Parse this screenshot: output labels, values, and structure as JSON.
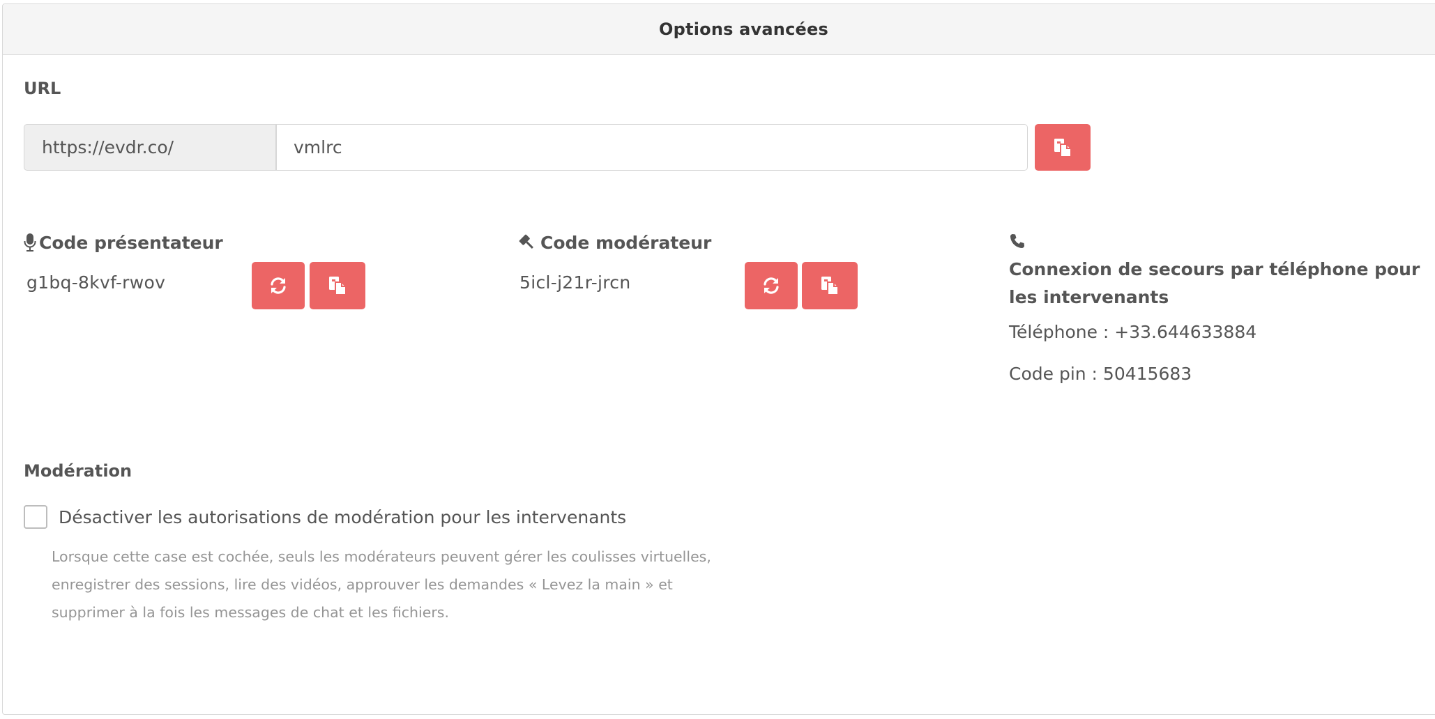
{
  "panel": {
    "title": "Options avancées"
  },
  "url": {
    "label": "URL",
    "prefix": "https://evdr.co/",
    "value": "vmlrc",
    "copy_icon": "copy-icon"
  },
  "presenter": {
    "label": "Code présentateur",
    "icon": "microphone-icon",
    "code": "g1bq-8kvf-rwov"
  },
  "moderator": {
    "label": "Code modérateur",
    "icon": "gavel-icon",
    "code": "5icl-j21r-jrcn"
  },
  "phone": {
    "icon": "phone-icon",
    "title": "Connexion de secours par téléphone pour les intervenants",
    "telephone": "Téléphone : +33.644633884",
    "pin": "Code pin : 50415683"
  },
  "moderation": {
    "label": "Modération",
    "checkbox_label": "Désactiver les autorisations de modération pour les intervenants",
    "checked": false,
    "help": "Lorsque cette case est cochée, seuls les modérateurs peuvent gérer les coulisses virtuelles, enregistrer des sessions, lire des vidéos, approuver les demandes « Levez la main » et supprimer à la fois les messages de chat et les fichiers."
  },
  "colors": {
    "accent": "#ec6565",
    "text": "#555555",
    "muted": "#959595",
    "header_bg": "#f5f5f5"
  }
}
